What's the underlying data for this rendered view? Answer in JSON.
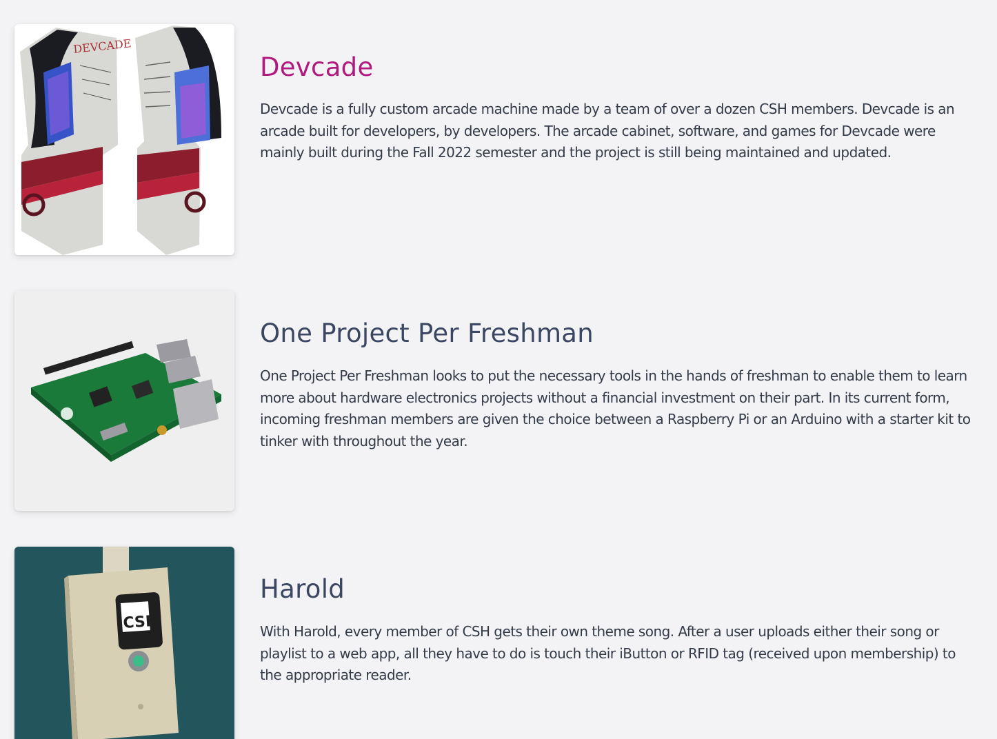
{
  "projects": [
    {
      "title": "Devcade",
      "description": "Devcade is a fully custom arcade machine made by a team of over a dozen CSH members. Devcade is an arcade built for developers, by developers. The arcade cabinet, software, and games for Devcade were mainly built during the Fall 2022 semester and the project is still being maintained and updated.",
      "image": "arcade-cabinet-photo",
      "image_text": "DEVCADE"
    },
    {
      "title": "One Project Per Freshman",
      "description": "One Project Per Freshman looks to put the necessary tools in the hands of freshman to enable them to learn more about hardware electronics projects without a financial investment on their part. In its current form, incoming freshman members are given the choice between a Raspberry Pi or an Arduino with a starter kit to tinker with throughout the year.",
      "image": "raspberry-pi-board-photo"
    },
    {
      "title": "Harold",
      "description": "With Harold, every member of CSH gets their own theme song. After a user uploads either their song or playlist to a web app, all they have to do is touch their iButton or RFID tag (received upon membership) to the appropriate reader.",
      "image": "rfid-reader-photo",
      "image_text": "CSH"
    }
  ],
  "colors": {
    "background": "#f3f3f5",
    "accent_title": "#b0197e",
    "title": "#3b4662",
    "body_text": "#333a48"
  }
}
